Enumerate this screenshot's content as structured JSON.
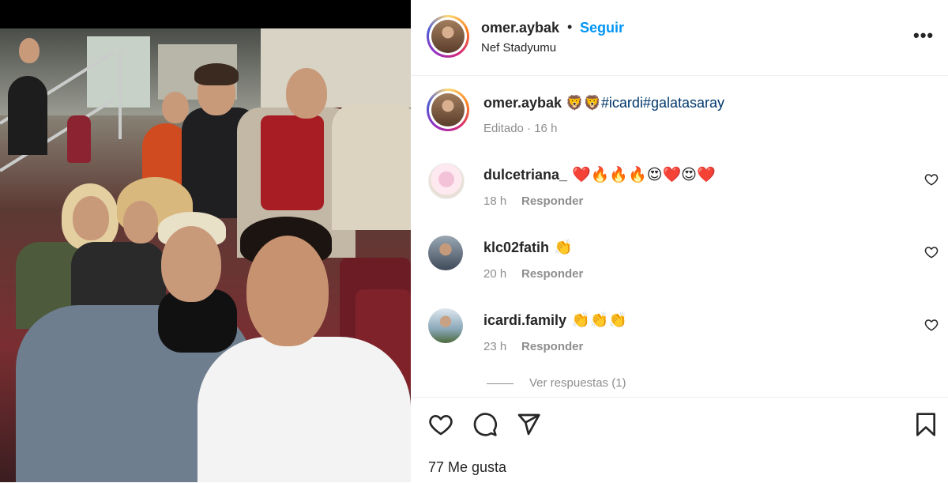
{
  "post": {
    "author": "omer.aybak",
    "follow_label": "Seguir",
    "separator": "•",
    "location": "Nef Stadyumu",
    "more_label": "•••"
  },
  "caption": {
    "username": "omer.aybak",
    "emojis": "🦁🦁",
    "hashtags": "#icardi#galatasaray",
    "edited": "Editado",
    "dot": "·",
    "time": "16 h"
  },
  "comments": [
    {
      "username": "dulcetriana_",
      "text": "❤️🔥🔥🔥😍❤️😍❤️",
      "time": "18 h",
      "reply_label": "Responder"
    },
    {
      "username": "klc02fatih",
      "text": "👏",
      "time": "20 h",
      "reply_label": "Responder"
    },
    {
      "username": "icardi.family",
      "text": "👏👏👏",
      "time": "23 h",
      "reply_label": "Responder"
    }
  ],
  "view_replies": "Ver respuestas (1)",
  "likes": "77 Me gusta",
  "icons": {
    "like": "heart-icon",
    "comment": "comment-bubble-icon",
    "share": "paper-plane-icon",
    "save": "bookmark-icon",
    "more": "ellipsis-icon"
  },
  "colors": {
    "follow_blue": "#0095f6",
    "hashtag": "#00376b",
    "secondary_text": "#8e8e8e"
  }
}
